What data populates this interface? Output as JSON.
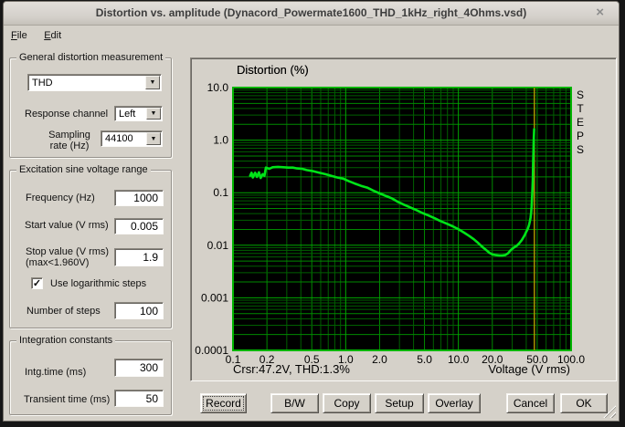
{
  "window": {
    "title": "Distortion vs. amplitude (Dynacord_Powermate1600_THD_1kHz_right_4Ohms.vsd)"
  },
  "icons": {
    "close": "×",
    "dropdown": "▼",
    "check": "✓"
  },
  "menu": {
    "file": "File",
    "edit": "Edit"
  },
  "general_group": {
    "title": "General distortion measurement",
    "measurement_value": "THD",
    "response_channel_label": "Response channel",
    "response_channel_value": "Left",
    "sampling_rate_label": "Sampling\nrate (Hz)",
    "sampling_rate_value": "44100"
  },
  "excitation_group": {
    "title": "Excitation sine voltage range",
    "frequency_label": "Frequency (Hz)",
    "frequency_value": "1000",
    "start_label": "Start value (V rms)",
    "start_value": "0.005",
    "stop_label": "Stop value (V rms)\n (max<1.960V)",
    "stop_value": "1.9",
    "log_steps_label": "Use logarithmic steps",
    "log_steps_checked": true,
    "steps_label": "Number of steps",
    "steps_value": "100"
  },
  "integration_group": {
    "title": "Integration constants",
    "intg_label": "Intg.time (ms)",
    "intg_value": "300",
    "transient_label": "Transient time (ms)",
    "transient_value": "50"
  },
  "buttons": {
    "record": "Record",
    "bw": "B/W",
    "copy": "Copy",
    "setup": "Setup",
    "overlay": "Overlay",
    "cancel": "Cancel",
    "ok": "OK"
  },
  "chart_data": {
    "type": "line",
    "title": "Distortion (%)",
    "xlabel": "Voltage (V rms)",
    "right_label": "STEPS",
    "cursor_text": "Crsr:47.2V, THD:1.3%",
    "x_scale": "log",
    "y_scale": "log",
    "xlim": [
      0.1,
      100
    ],
    "ylim": [
      0.0001,
      10
    ],
    "x_ticks": [
      "0.1",
      "0.2",
      "0.5",
      "1.0",
      "2.0",
      "5.0",
      "10.0",
      "20.0",
      "50.0",
      "100.0"
    ],
    "x_tick_values": [
      0.1,
      0.2,
      0.5,
      1,
      2,
      5,
      10,
      20,
      50,
      100
    ],
    "y_ticks": [
      "10.0",
      "1.0",
      "0.1",
      "0.01",
      "0.001",
      "0.0001"
    ],
    "y_tick_values": [
      10,
      1,
      0.1,
      0.01,
      0.001,
      0.0001
    ],
    "grid": true,
    "legend": null,
    "cursor_x": 47.2,
    "colors": {
      "background": "#000000",
      "grid_major": "#00a800",
      "grid_mid": "#008a00",
      "grid_minor": "#006000",
      "frame": "#00b400",
      "curve": "#00e418",
      "cursor": "#b49b00",
      "text": "#000000"
    },
    "series": [
      {
        "name": "THD",
        "points": [
          [
            0.142,
            0.21
          ],
          [
            0.146,
            0.24
          ],
          [
            0.15,
            0.195
          ],
          [
            0.157,
            0.24
          ],
          [
            0.163,
            0.2
          ],
          [
            0.17,
            0.245
          ],
          [
            0.176,
            0.19
          ],
          [
            0.183,
            0.225
          ],
          [
            0.19,
            0.21
          ],
          [
            0.196,
            0.3
          ],
          [
            0.21,
            0.285
          ],
          [
            0.225,
            0.305
          ],
          [
            0.25,
            0.31
          ],
          [
            0.28,
            0.305
          ],
          [
            0.31,
            0.3
          ],
          [
            0.34,
            0.3
          ],
          [
            0.37,
            0.29
          ],
          [
            0.41,
            0.285
          ],
          [
            0.45,
            0.27
          ],
          [
            0.5,
            0.26
          ],
          [
            0.58,
            0.24
          ],
          [
            0.66,
            0.225
          ],
          [
            0.74,
            0.21
          ],
          [
            0.84,
            0.195
          ],
          [
            0.95,
            0.185
          ],
          [
            1.07,
            0.165
          ],
          [
            1.2,
            0.15
          ],
          [
            1.37,
            0.135
          ],
          [
            1.55,
            0.125
          ],
          [
            1.75,
            0.11
          ],
          [
            2.0,
            0.097
          ],
          [
            2.3,
            0.086
          ],
          [
            2.6,
            0.077
          ],
          [
            2.9,
            0.067
          ],
          [
            3.3,
            0.059
          ],
          [
            3.7,
            0.053
          ],
          [
            4.2,
            0.047
          ],
          [
            4.8,
            0.041
          ],
          [
            5.4,
            0.037
          ],
          [
            6.1,
            0.033
          ],
          [
            6.9,
            0.029
          ],
          [
            7.8,
            0.026
          ],
          [
            8.9,
            0.023
          ],
          [
            10.1,
            0.02
          ],
          [
            11.4,
            0.017
          ],
          [
            12.5,
            0.015
          ],
          [
            13.7,
            0.013
          ],
          [
            15,
            0.011
          ],
          [
            16.6,
            0.009
          ],
          [
            18,
            0.0078
          ],
          [
            18.8,
            0.0072
          ],
          [
            20,
            0.0067
          ],
          [
            21.5,
            0.0065
          ],
          [
            23,
            0.0064
          ],
          [
            24.5,
            0.0064
          ],
          [
            26,
            0.0065
          ],
          [
            27.5,
            0.007
          ],
          [
            29,
            0.008
          ],
          [
            31,
            0.009
          ],
          [
            33,
            0.0098
          ],
          [
            34.5,
            0.0108
          ],
          [
            36.5,
            0.0125
          ],
          [
            38.7,
            0.0155
          ],
          [
            40,
            0.018
          ],
          [
            41.3,
            0.0205
          ],
          [
            42.3,
            0.024
          ],
          [
            43,
            0.028
          ],
          [
            43.7,
            0.034
          ],
          [
            44.2,
            0.042
          ],
          [
            44.6,
            0.055
          ],
          [
            44.9,
            0.072
          ],
          [
            45.2,
            0.095
          ],
          [
            45.5,
            0.13
          ],
          [
            45.7,
            0.18
          ],
          [
            45.9,
            0.27
          ],
          [
            46.1,
            0.4
          ],
          [
            46.3,
            0.6
          ],
          [
            46.5,
            0.85
          ],
          [
            46.7,
            1.1
          ],
          [
            46.9,
            1.35
          ],
          [
            47.05,
            1.62
          ]
        ]
      }
    ]
  }
}
